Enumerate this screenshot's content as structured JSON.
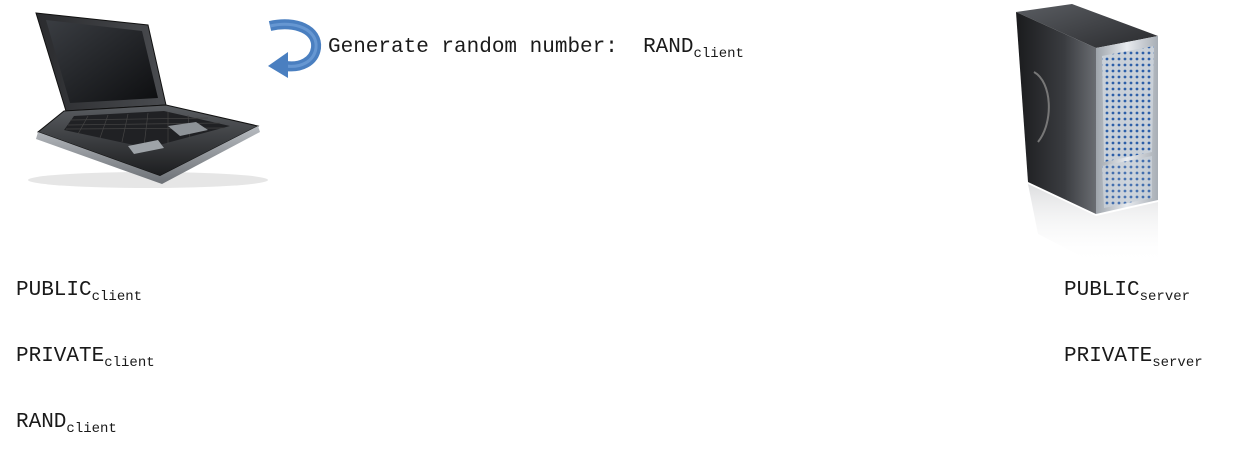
{
  "generate_step": {
    "text": "Generate random number:",
    "value_main": "RAND",
    "value_sub": "client"
  },
  "client": {
    "icon": "laptop-icon",
    "public": {
      "main": "PUBLIC",
      "sub": "client"
    },
    "private": {
      "main": "PRIVATE",
      "sub": "client"
    },
    "rand": {
      "main": "RAND",
      "sub": "client"
    }
  },
  "server": {
    "icon": "server-icon",
    "public": {
      "main": "PUBLIC",
      "sub": "server"
    },
    "private": {
      "main": "PRIVATE",
      "sub": "server"
    }
  },
  "colors": {
    "arrow": "#4a7fc0",
    "text": "#1a1a1a"
  }
}
